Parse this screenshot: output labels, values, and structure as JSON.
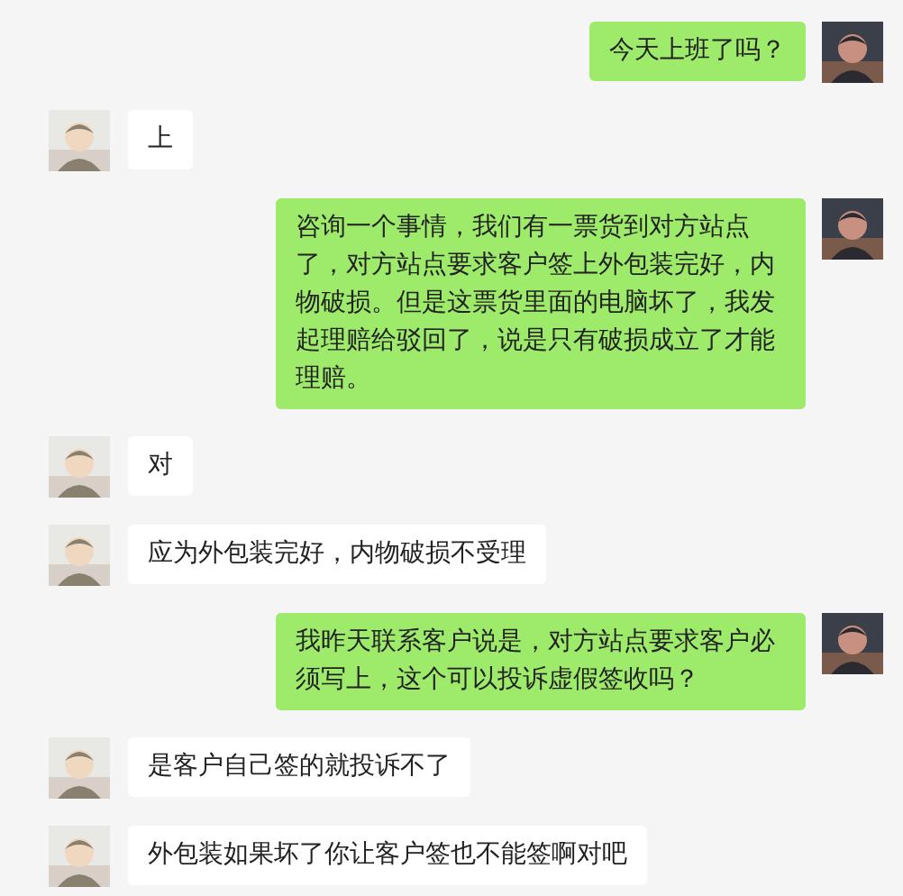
{
  "messages": [
    {
      "kind": "sent",
      "text": "今天上班了吗？"
    },
    {
      "kind": "received",
      "text": "上"
    },
    {
      "kind": "sent",
      "text": "咨询一个事情，我们有一票货到对方站点了，对方站点要求客户签上外包装完好，内物破损。但是这票货里面的电脑坏了，我发起理赔给驳回了，说是只有破损成立了才能理赔。"
    },
    {
      "kind": "received",
      "text": "对"
    },
    {
      "kind": "received",
      "text": "应为外包装完好，内物破损不受理"
    },
    {
      "kind": "sent",
      "text": "我昨天联系客户说是，对方站点要求客户必须写上，这个可以投诉虚假签收吗？"
    },
    {
      "kind": "received",
      "text": "是客户自己签的就投诉不了"
    },
    {
      "kind": "received",
      "text": "外包装如果坏了你让客户签也不能签啊对吧"
    }
  ]
}
